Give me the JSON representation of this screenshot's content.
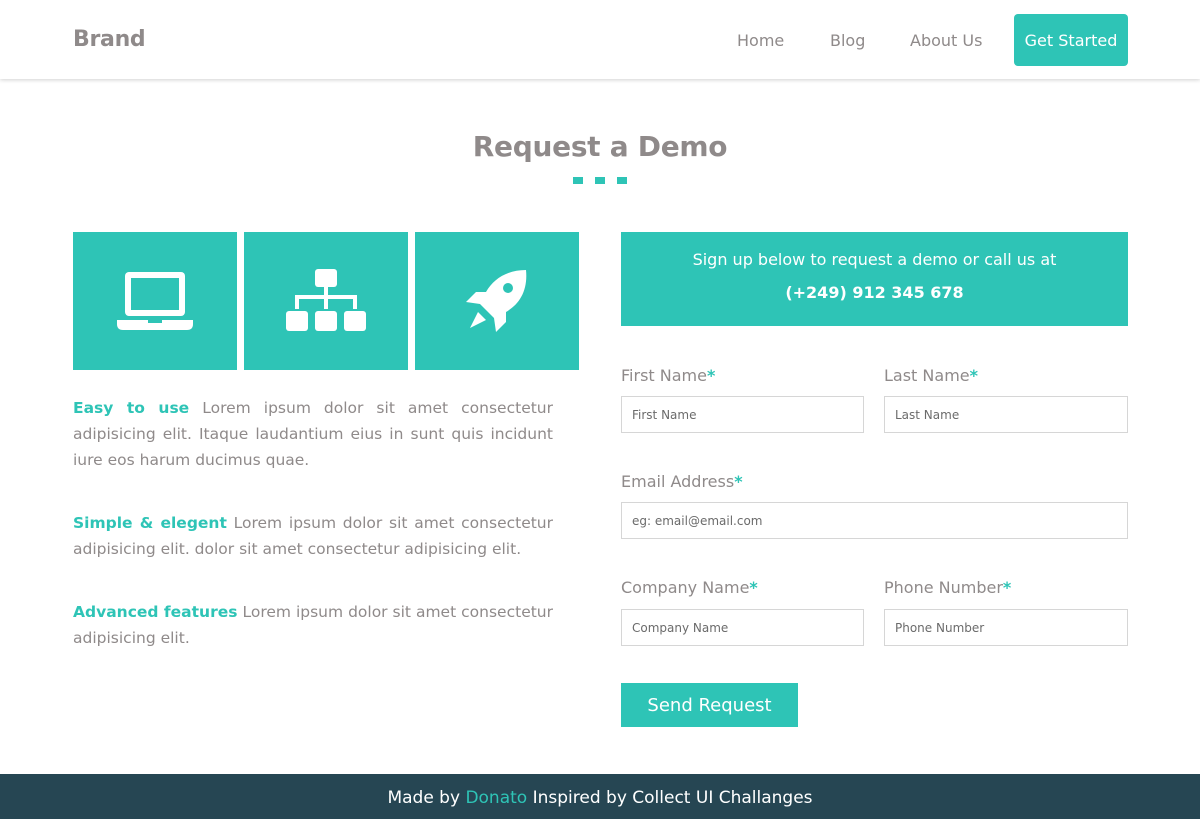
{
  "header": {
    "brand": "Brand",
    "nav": {
      "home": "Home",
      "blog": "Blog",
      "about": "About Us"
    },
    "cta_label": "Get Started"
  },
  "main": {
    "title": "Request a Demo",
    "tiles": [
      {
        "icon": "laptop-icon"
      },
      {
        "icon": "sitemap-icon"
      },
      {
        "icon": "rocket-icon"
      }
    ],
    "features": [
      {
        "title": "Easy to use",
        "text": "Lorem ipsum dolor sit amet consectetur adipisicing elit. Itaque laudantium eius in sunt quis incidunt iure eos harum ducimus quae."
      },
      {
        "title": "Simple & elegent",
        "text": "Lorem ipsum dolor sit amet consectetur adipisicing elit. dolor sit amet consectetur adipisicing elit."
      },
      {
        "title": "Advanced features",
        "text": "Lorem ipsum dolor sit amet consectetur adipisicing elit."
      }
    ],
    "banner": {
      "text": "Sign up below to request a demo or call us at",
      "phone": "(+249) 912 345 678"
    },
    "form": {
      "required_mark": "*",
      "first_name": {
        "label": "First Name",
        "placeholder": "First Name"
      },
      "last_name": {
        "label": "Last Name",
        "placeholder": "Last Name"
      },
      "email": {
        "label": "Email Address",
        "placeholder": "eg: email@email.com"
      },
      "company": {
        "label": "Company Name",
        "placeholder": "Company Name"
      },
      "phone": {
        "label": "Phone Number",
        "placeholder": "Phone Number"
      },
      "submit_label": "Send Request"
    }
  },
  "footer": {
    "prefix": "Made by",
    "author": "Donato",
    "suffix": "Inspired by Collect UI Challanges"
  },
  "colors": {
    "accent": "#2ec4b6",
    "text": "#8f8a8a",
    "footer_bg": "#264653"
  }
}
